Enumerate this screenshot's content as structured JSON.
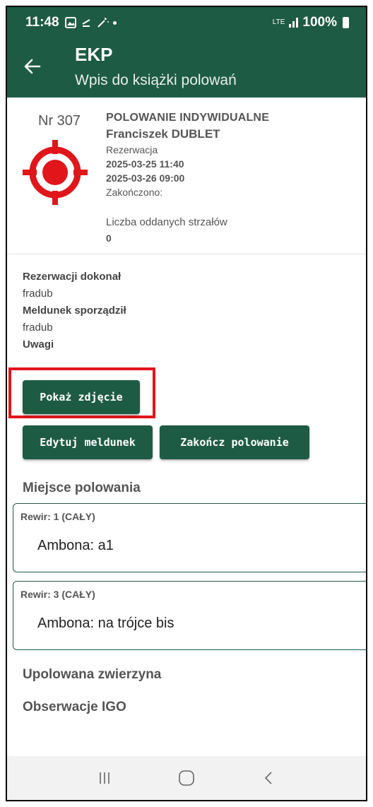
{
  "status_bar": {
    "time": "11:48",
    "notification_icons": [
      "image-icon",
      "download-icon",
      "wand-icon",
      "dot-icon"
    ],
    "network": "LTE",
    "battery": "100%"
  },
  "app_bar": {
    "title": "EKP",
    "subtitle": "Wpis do książki polowań"
  },
  "hunt": {
    "number": "Nr 307",
    "type": "POLOWANIE INDYWIDUALNE",
    "hunter": "Franciszek DUBLET",
    "status": "Rezerwacja",
    "start": "2025-03-25 11:40",
    "end": "2025-03-26 09:00",
    "finished": "Zakończono:",
    "shots_label": "Liczba oddanych strzałów",
    "shots_value": "0"
  },
  "details": {
    "reserved_by_label": "Rezerwacji dokonał",
    "reserved_by": "fradub",
    "report_by_label": "Meldunek sporządził",
    "report_by": "fradub",
    "notes_label": "Uwagi"
  },
  "buttons": {
    "show_photo": "Pokaż zdjęcie",
    "edit_report": "Edytuj meldunek",
    "end_hunt": "Zakończ polowanie"
  },
  "places": {
    "title": "Miejsce polowania",
    "items": [
      {
        "rewir": "Rewir: 1 (CAŁY)",
        "ambona": "Ambona: a1"
      },
      {
        "rewir": "Rewir: 3 (CAŁY)",
        "ambona": "Ambona: na trójce bis"
      }
    ]
  },
  "sections": {
    "game": "Upolowana zwierzyna",
    "observations": "Obserwacje IGO"
  },
  "colors": {
    "primary": "#1e5b45",
    "target_red": "#e0161b",
    "highlight": "#e0161b"
  }
}
